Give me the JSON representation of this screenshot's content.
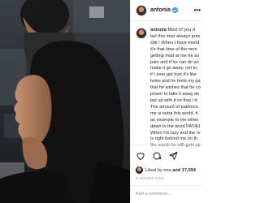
{
  "post": {
    "username": "antonia",
    "verified": true,
    "more_label": "•••",
    "caption_lines": [
      "Most of you d",
      "but this man always puts",
      "shit ! When I have mood",
      "it's that time of the mon",
      "getting mad at me he as",
      "pain and if he can do an",
      "make it go away, not to",
      "if I ever get hurt it's like",
      "twins and he feels my pa",
      "that he wishes that he co",
      "power to take it away an",
      "put up with it so that I d",
      "The amount of patience",
      "me is outta this world, h",
      "an example to me when",
      "down to the word PATIEI",
      "When I'm lazy and the re",
      "is right behind me on th",
      "the couch he still gets up"
    ],
    "likes_text": "Liked by ena",
    "likes_text_2": "and 17,594",
    "time_ago": "9 HOURS AGO",
    "comment_placeholder": "Add a comment..."
  },
  "icons": [
    "heart-icon",
    "comment-icon",
    "share-icon"
  ],
  "colors": {
    "verified": "#3897f0",
    "muted": "#8e8e8e",
    "divider": "#efefef"
  }
}
